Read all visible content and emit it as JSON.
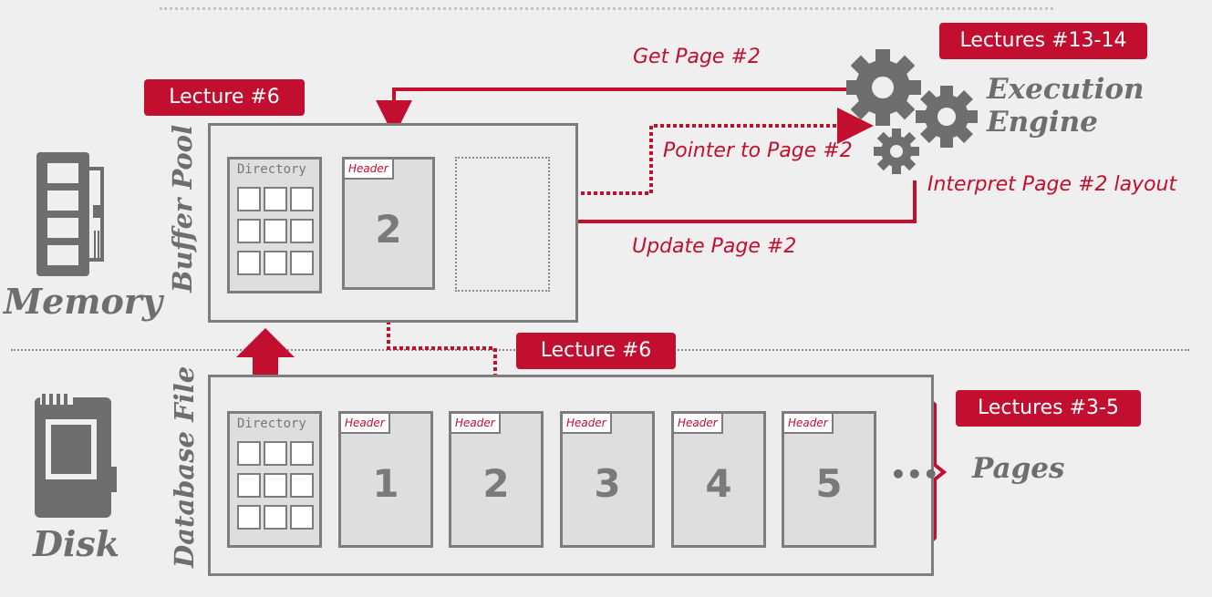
{
  "badges": {
    "lectures_13_14": "Lectures #13-14",
    "lecture_6_top": "Lecture #6",
    "lecture_6_mid": "Lecture #6",
    "lectures_3_5": "Lectures #3-5"
  },
  "labels": {
    "memory": "Memory",
    "disk": "Disk",
    "buffer_pool": "Buffer Pool",
    "database_file": "Database File",
    "execution_engine_line1": "Execution",
    "execution_engine_line2": "Engine",
    "pages": "Pages",
    "ellipsis": "•••"
  },
  "annotations": {
    "get_page": "Get Page #2",
    "pointer_to_page": "Pointer to Page #2",
    "interpret_layout": "Interpret Page #2 layout",
    "update_page": "Update Page #2"
  },
  "buffer_pool": {
    "directory_label": "Directory",
    "page": {
      "header": "Header",
      "number": "2"
    }
  },
  "database_file": {
    "directory_label": "Directory",
    "pages": [
      {
        "header": "Header",
        "number": "1"
      },
      {
        "header": "Header",
        "number": "2"
      },
      {
        "header": "Header",
        "number": "3"
      },
      {
        "header": "Header",
        "number": "4"
      },
      {
        "header": "Header",
        "number": "5"
      }
    ]
  },
  "colors": {
    "accent": "#c20f2f",
    "gray": "#7d7d7d",
    "background": "#efefef"
  },
  "icons": {
    "memory": "ram-stick-icon",
    "disk": "ssd-drive-icon",
    "engine": "gears-icon"
  }
}
